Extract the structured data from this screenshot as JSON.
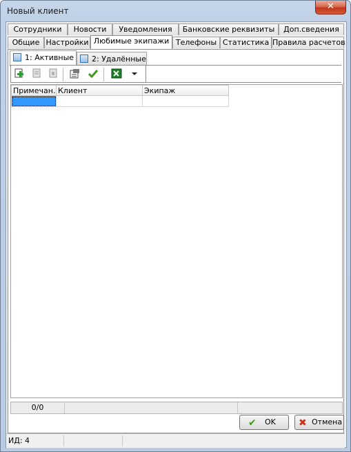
{
  "window": {
    "title": "Новый клиент",
    "close_glyph": "✕"
  },
  "tabs_row1": [
    "Сотрудники",
    "Новости",
    "Уведомления",
    "Банковские реквизиты",
    "Доп.сведения"
  ],
  "tabs_row2": [
    "Общие",
    "Настройки",
    "Любимые экипажи",
    "Телефоны",
    "Статистика",
    "Правила расчетов"
  ],
  "active_tab": "Любимые экипажи",
  "subtabs": [
    "1: Активные",
    "2: Удалённые"
  ],
  "active_subtab": "1: Активные",
  "toolbar": {
    "icons": [
      "add-icon",
      "edit-icon",
      "delete-icon",
      "properties-icon",
      "check-icon",
      "excel-icon",
      "dropdown-arrow-icon"
    ],
    "search_value": ""
  },
  "grid": {
    "columns": [
      "Примечан...",
      "Клиент",
      "Экипаж"
    ],
    "rows": [
      [
        "",
        "",
        ""
      ]
    ]
  },
  "status": {
    "count": "0/0"
  },
  "buttons": {
    "ok": "OK",
    "cancel": "Отмена"
  },
  "footer": {
    "id_text": "ИД: 4"
  },
  "colors": {
    "selected_cell": "#3399ff",
    "ok_icon": "#3a9a1a",
    "cancel_icon": "#c8321e"
  }
}
